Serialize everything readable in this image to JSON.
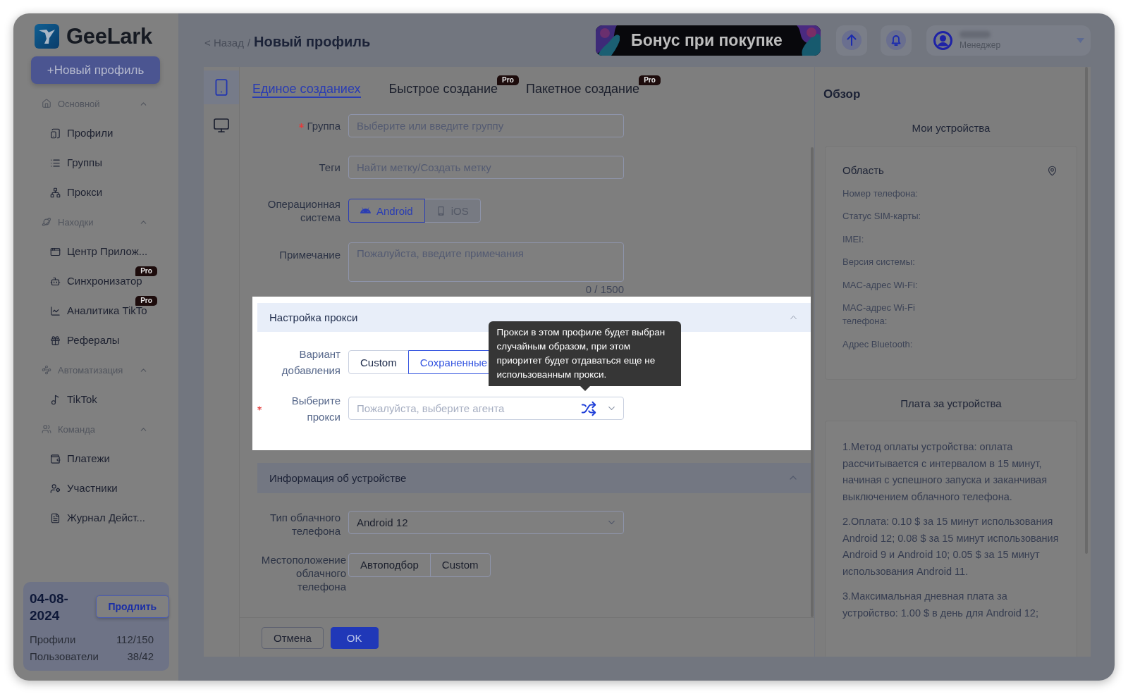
{
  "sidebar": {
    "logo": "GeeLark",
    "new_profile_button": "+Новый профиль",
    "groups": [
      {
        "title": "Основной",
        "expanded": true,
        "items": [
          {
            "label": "Профили",
            "selected": false
          },
          {
            "label": "Группы",
            "selected": false
          },
          {
            "label": "Прокси",
            "selected": false
          }
        ]
      },
      {
        "title": "Находки",
        "expanded": true,
        "items": [
          {
            "label": "Центр Прилож...",
            "selected": false
          },
          {
            "label": "Синхронизатор",
            "selected": false,
            "badge": "Pro"
          },
          {
            "label": "Аналитика TikTo",
            "selected": false,
            "badge": "Pro"
          },
          {
            "label": "Рефералы",
            "selected": false
          }
        ]
      },
      {
        "title": "Автоматизация",
        "expanded": true,
        "items": [
          {
            "label": "TikTok",
            "selected": false
          }
        ]
      },
      {
        "title": "Команда",
        "expanded": true,
        "items": [
          {
            "label": "Платежи",
            "selected": false
          },
          {
            "label": "Участники",
            "selected": false
          },
          {
            "label": "Журнал Дейст...",
            "selected": false
          }
        ]
      }
    ],
    "plan": {
      "expiry": "04-08-2024",
      "renew_button": "Продлить",
      "stats": [
        {
          "label": "Профили",
          "value": "112/150"
        },
        {
          "label": "Пользователи",
          "value": "38/42"
        }
      ]
    }
  },
  "header": {
    "back_link": "< Назад",
    "separator": "/",
    "title": "Новый профиль",
    "banner": "Бонус при покупке",
    "user": {
      "role": "Менеджер"
    }
  },
  "rail": [
    {
      "selected": true
    },
    {
      "selected": false
    }
  ],
  "tabs": [
    {
      "label": "Единое созданиех",
      "selected": true
    },
    {
      "label": "Быстрое создание",
      "selected": false,
      "badge": "Pro"
    },
    {
      "label": "Пакетное создание",
      "selected": false,
      "badge": "Pro"
    }
  ],
  "form": {
    "fields": [
      {
        "kind": "input",
        "label": "Группа",
        "required": true,
        "placeholder": "Выберите или введите группу"
      },
      {
        "kind": "input",
        "label": "Теги",
        "required": false,
        "placeholder": "Найти метку/Создать метку"
      },
      {
        "kind": "segmented",
        "label": "Операционная система",
        "required": false,
        "options": [
          {
            "label": "Android",
            "selected": true,
            "disabled": false
          },
          {
            "label": "iOS",
            "selected": false,
            "disabled": true
          }
        ]
      },
      {
        "kind": "textarea",
        "label": "Примечание",
        "required": false,
        "placeholder": "Пожалуйста, введите примечания",
        "counter": "0 / 1500"
      }
    ]
  },
  "proxy_section": {
    "title": "Настройка прокси",
    "expanded": true,
    "fields": [
      {
        "kind": "segmented",
        "label": "Вариант добавления",
        "required": false,
        "options": [
          {
            "label": "Custom",
            "selected": false
          },
          {
            "label": "Сохраненные",
            "selected": true
          }
        ]
      },
      {
        "kind": "select",
        "label": "Выберите прокси",
        "required": true,
        "placeholder": "Пожалуйста, выберите агента",
        "random": true
      }
    ],
    "tooltip": "Прокси в этом профиле будет выбран случайным образом, при этом приоритет будет отдаваться еще не использованным прокси."
  },
  "device_section": {
    "title": "Информация об устройстве",
    "expanded": true,
    "fields": [
      {
        "kind": "select",
        "label": "Тип облачного телефона",
        "required": false,
        "value": "Android 12"
      },
      {
        "kind": "segmented",
        "label": "Местоположение облачного телефона",
        "required": false,
        "options": [
          {
            "label": "Автоподбор",
            "selected": false
          },
          {
            "label": "Custom",
            "selected": false
          }
        ]
      }
    ]
  },
  "footer": {
    "buttons": [
      {
        "label": "Отмена",
        "kind": "secondary"
      },
      {
        "label": "OK",
        "kind": "primary"
      }
    ]
  },
  "overview": {
    "title": "Обзор",
    "devices": {
      "title": "Мои устройства",
      "region": "Область",
      "fields": [
        "Номер телефона:",
        "Статус SIM-карты:",
        "IMEI:",
        "Версия системы:",
        "MAC-адрес Wi-Fi:",
        "MAC-адрес Wi-Fi телефона:",
        "Адрес Bluetooth:"
      ]
    },
    "pricing": {
      "title": "Плата за устройства",
      "paragraphs": [
        "1.Метод оплаты устройства: оплата рассчитывается с интервалом в 15 минут, начиная с успешного запуска и заканчивая выключением облачного телефона.",
        "2.Оплата: 0.10 $ за 15 минут использования Android 12; 0.08 $ за 15 минут использования Android 9 и Android 10; 0.05 $ за 15 минут использования Android 11.",
        "3.Максимальная дневная плата за устройство: 1.00 $ в день для Android 12;"
      ]
    }
  }
}
